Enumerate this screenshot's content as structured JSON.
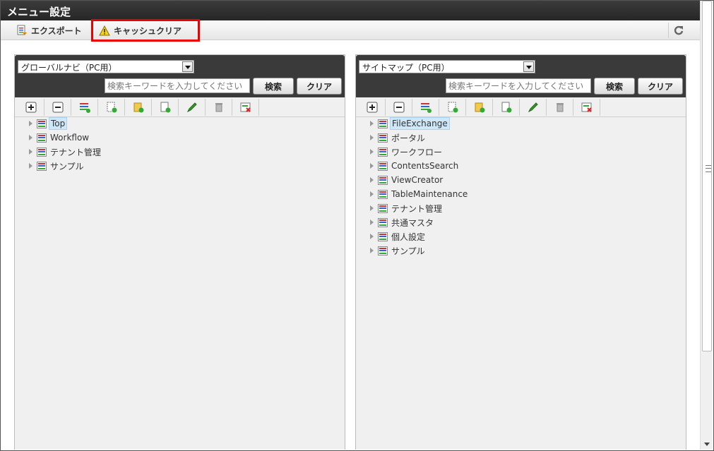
{
  "window": {
    "title": "メニュー設定"
  },
  "toolbar": {
    "export_label": "エクスポート",
    "cache_clear_label": "キャッシュクリア"
  },
  "panels": [
    {
      "select_value": "グローバルナビ（PC用）",
      "search_placeholder": "検索キーワードを入力してください",
      "search_button": "検索",
      "clear_button": "クリア",
      "nodes": [
        {
          "label": "Top",
          "selected": true
        },
        {
          "label": "Workflow",
          "selected": false
        },
        {
          "label": "テナント管理",
          "selected": false
        },
        {
          "label": "サンプル",
          "selected": false
        }
      ]
    },
    {
      "select_value": "サイトマップ（PC用）",
      "search_placeholder": "検索キーワードを入力してください",
      "search_button": "検索",
      "clear_button": "クリア",
      "nodes": [
        {
          "label": "FileExchange",
          "selected": true
        },
        {
          "label": "ポータル",
          "selected": false
        },
        {
          "label": "ワークフロー",
          "selected": false
        },
        {
          "label": "ContentsSearch",
          "selected": false
        },
        {
          "label": "ViewCreator",
          "selected": false
        },
        {
          "label": "TableMaintenance",
          "selected": false
        },
        {
          "label": "テナント管理",
          "selected": false
        },
        {
          "label": "共通マスタ",
          "selected": false
        },
        {
          "label": "個人設定",
          "selected": false
        },
        {
          "label": "サンプル",
          "selected": false
        }
      ]
    }
  ],
  "panel_tool_icons": [
    "expand-all-icon",
    "collapse-all-icon",
    "add-node-icon",
    "add-page-icon",
    "add-folder-icon",
    "new-item-icon",
    "edit-icon",
    "delete-icon",
    "remove-icon"
  ],
  "colors": {
    "titlebar": "#2f2f2f",
    "highlight": "#e00000",
    "selected_node": "#cde8fb"
  }
}
